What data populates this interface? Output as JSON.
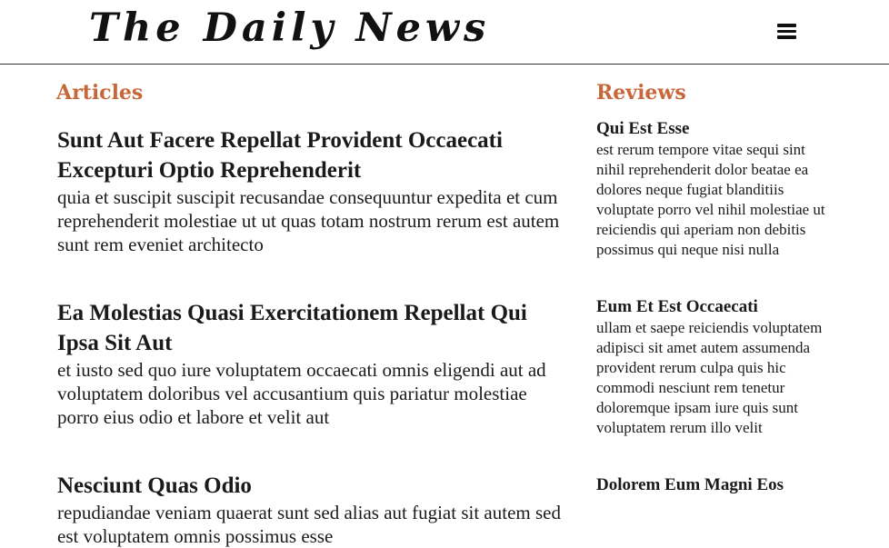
{
  "header": {
    "brand": "The Daily News",
    "menu_icon": "hamburger-menu-icon"
  },
  "colors": {
    "accent": "#c8683a",
    "text": "#1a1a1a",
    "border": "#333333"
  },
  "articles": {
    "title": "Articles",
    "items": [
      {
        "title": "Sunt Aut Facere Repellat Provident Occaecati Excepturi Optio Reprehenderit",
        "body": "quia et suscipit suscipit recusandae consequuntur expedita et cum reprehenderit molestiae ut ut quas totam nostrum rerum est autem sunt rem eveniet architecto"
      },
      {
        "title": "Ea Molestias Quasi Exercitationem Repellat Qui Ipsa Sit Aut",
        "body": "et iusto sed quo iure voluptatem occaecati omnis eligendi aut ad voluptatem doloribus vel accusantium quis pariatur molestiae porro eius odio et labore et velit aut"
      },
      {
        "title": "Nesciunt Quas Odio",
        "body": "repudiandae veniam quaerat sunt sed alias aut fugiat sit autem sed est voluptatem omnis possimus esse"
      }
    ]
  },
  "reviews": {
    "title": "Reviews",
    "items": [
      {
        "title": "Qui Est Esse",
        "body": "est rerum tempore vitae sequi sint nihil reprehenderit dolor beatae ea dolores neque fugiat blanditiis voluptate porro vel nihil molestiae ut reiciendis qui aperiam non debitis possimus qui neque nisi nulla"
      },
      {
        "title": "Eum Et Est Occaecati",
        "body": "ullam et saepe reiciendis voluptatem adipisci sit amet autem assumenda provident rerum culpa quis hic commodi nesciunt rem tenetur doloremque ipsam iure quis sunt voluptatem rerum illo velit"
      },
      {
        "title": "Dolorem Eum Magni Eos",
        "body": ""
      }
    ]
  }
}
